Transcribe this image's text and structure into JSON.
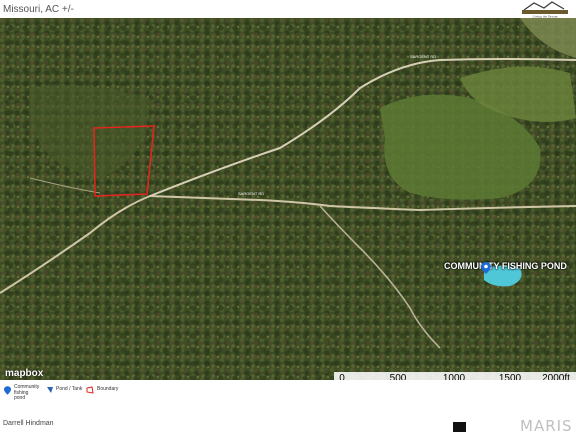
{
  "header": {
    "title": "Missouri,  AC +/-",
    "logo_text": "Living the Dream"
  },
  "map": {
    "pond_label": "COMMUNITY FISHING POND",
    "road_label": "SARGENT RD",
    "attribution": "mapbox",
    "scale": {
      "labels": [
        "0",
        "500",
        "1000",
        "1500",
        "2000ft"
      ],
      "values_ft": [
        0,
        500,
        1000,
        1500,
        2000
      ]
    },
    "colors": {
      "boundary": "#e0271f",
      "pond": "#4fc7d6",
      "forest": "#3a4a22"
    }
  },
  "legend": {
    "items": [
      {
        "icon": "map-pin-icon",
        "label": "Community fishing pond"
      },
      {
        "icon": "pond-shape-icon",
        "label": "Pond / Tank"
      },
      {
        "icon": "boundary-shape-icon",
        "label": "Boundary"
      }
    ]
  },
  "footer": {
    "agent": "Darrell Hindman",
    "mls_brand": "MARIS"
  }
}
